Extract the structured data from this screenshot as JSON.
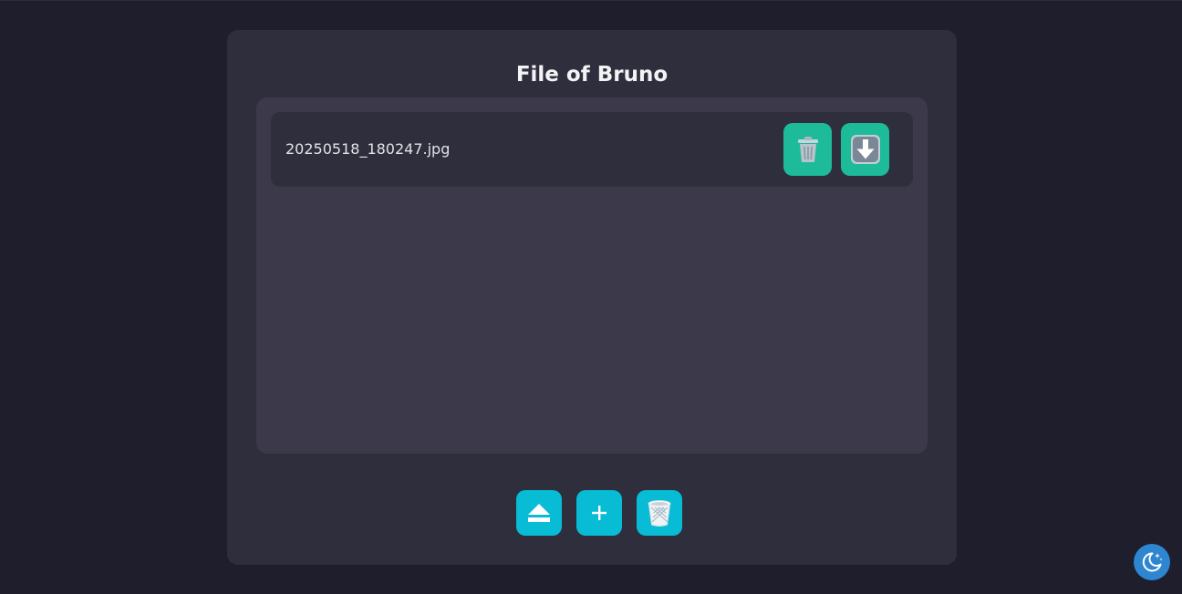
{
  "page": {
    "title": "File of Bruno"
  },
  "files": [
    {
      "name": "20250518_180247.jpg",
      "actions": [
        {
          "icon": "trash-icon"
        },
        {
          "icon": "download-arrow-icon"
        }
      ]
    }
  ],
  "toolbar": {
    "buttons": [
      {
        "icon": "eject-icon"
      },
      {
        "icon": "plus-icon"
      },
      {
        "icon": "wastebasket-icon"
      }
    ]
  },
  "theme_toggle": {
    "icon": "moon-stars-icon"
  },
  "colors": {
    "background": "#1f1e2c",
    "panel": "#2f2e3c",
    "file_area": "#3c3a4a",
    "row_action": "#1dbb9a",
    "toolbar_action": "#08bcd6",
    "theme_toggle": "#2e86d0"
  }
}
